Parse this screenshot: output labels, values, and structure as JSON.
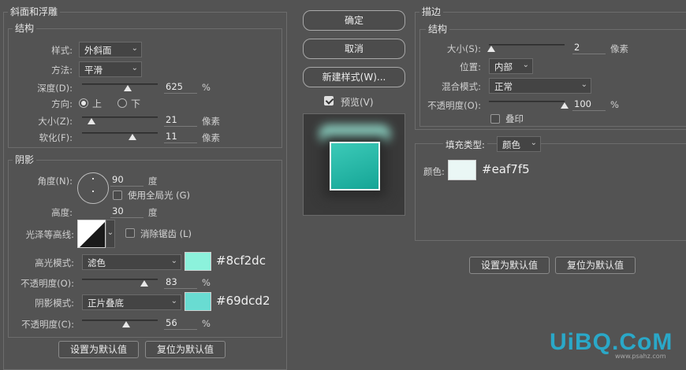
{
  "bevel": {
    "title": "斜面和浮雕",
    "structure_title": "结构",
    "style_label": "样式:",
    "style_value": "外斜面",
    "method_label": "方法:",
    "method_value": "平滑",
    "depth_label": "深度(D):",
    "depth_value": "625",
    "depth_unit": "%",
    "depth_level": 0.5,
    "direction_label": "方向:",
    "dir_up": "上",
    "dir_down": "下",
    "size_label": "大小(Z):",
    "size_value": "21",
    "size_unit": "像素",
    "size_level": 0.1,
    "soften_label": "软化(F):",
    "soften_value": "11",
    "soften_unit": "像素",
    "soften_level": 0.55,
    "shading_title": "阴影",
    "angle_label": "角度(N):",
    "angle_value": "90",
    "angle_unit": "度",
    "global_light_label": "使用全局光 (G)",
    "altitude_label": "高度:",
    "altitude_value": "30",
    "altitude_unit": "度",
    "gloss_label": "光泽等高线:",
    "antialias_label": "消除锯齿 (L)",
    "highlight_mode_label": "高光模式:",
    "highlight_mode_value": "滤色",
    "highlight_color": "#8cf2dc",
    "highlight_hex": "#8cf2dc",
    "highlight_opacity_label": "不透明度(O):",
    "highlight_opacity_value": "83",
    "highlight_opacity_unit": "%",
    "highlight_opacity_level": 0.83,
    "shadow_mode_label": "阴影模式:",
    "shadow_mode_value": "正片叠底",
    "shadow_color": "#69dcd2",
    "shadow_hex": "#69dcd2",
    "shadow_opacity_label": "不透明度(C):",
    "shadow_opacity_value": "56",
    "shadow_opacity_unit": "%",
    "shadow_opacity_level": 0.56,
    "make_default": "设置为默认值",
    "reset_default": "复位为默认值"
  },
  "actions": {
    "ok": "确定",
    "cancel": "取消",
    "new_style": "新建样式(W)...",
    "preview": "预览(V)"
  },
  "stroke": {
    "title": "描边",
    "structure_title": "结构",
    "size_label": "大小(S):",
    "size_value": "2",
    "size_unit": "像素",
    "size_level": 0.02,
    "position_label": "位置:",
    "position_value": "内部",
    "blend_label": "混合模式:",
    "blend_value": "正常",
    "opacity_label": "不透明度(O):",
    "opacity_value": "100",
    "opacity_unit": "%",
    "opacity_level": 1.0,
    "overprint_label": "叠印",
    "fill_type_label": "填充类型:",
    "fill_type_value": "颜色",
    "color_label": "颜色:",
    "color": "#eaf7f5",
    "color_hex": "#eaf7f5",
    "make_default": "设置为默认值",
    "reset_default": "复位为默认值"
  },
  "watermark": {
    "text": "UiBQ.CoM",
    "sub": "www.psahz.com"
  }
}
